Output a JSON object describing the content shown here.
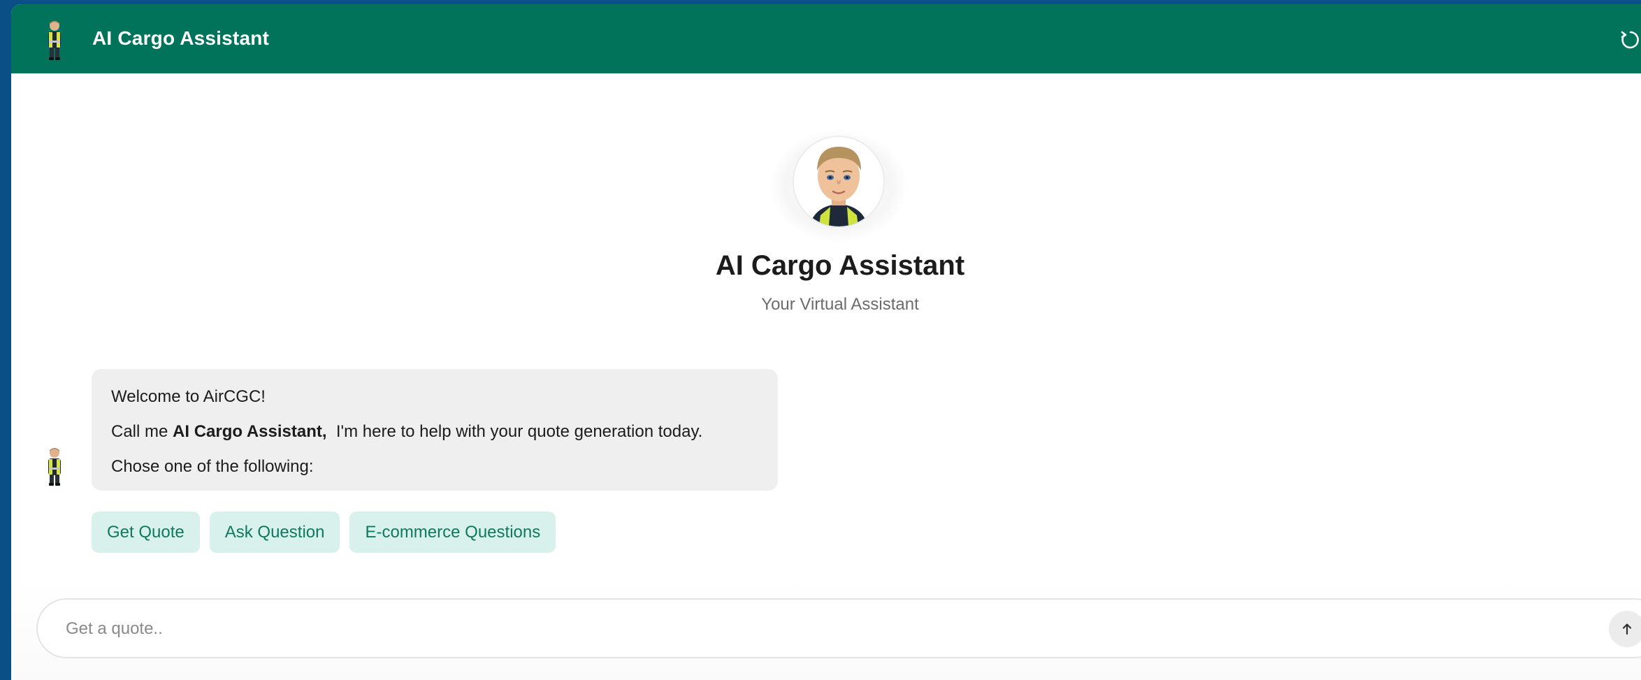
{
  "header": {
    "title": "AI Cargo Assistant",
    "background_color": "#00735a",
    "avatar_icon": "assistant-avatar-icon",
    "refresh_icon": "refresh-icon"
  },
  "hero": {
    "title": "AI Cargo Assistant",
    "subtitle": "Your Virtual Assistant",
    "avatar_icon": "assistant-avatar-icon"
  },
  "message": {
    "line1": "Welcome to AirCGC!",
    "line2_prefix": "Call me ",
    "line2_bold": "AI Cargo Assistant,",
    "line2_suffix": "  I'm here to help with your quote generation today.",
    "line3": "Chose one of the following:"
  },
  "options": [
    {
      "label": "Get Quote"
    },
    {
      "label": "Ask Question"
    },
    {
      "label": "E-commerce Questions"
    }
  ],
  "composer": {
    "placeholder": "Get a quote..",
    "send_icon": "arrow-up-icon"
  },
  "colors": {
    "brand": "#00735a",
    "option_bg": "#d9f1ec",
    "option_text": "#0d7a5f",
    "bubble_bg": "#efefef",
    "page_bg": "#0a4f86"
  }
}
